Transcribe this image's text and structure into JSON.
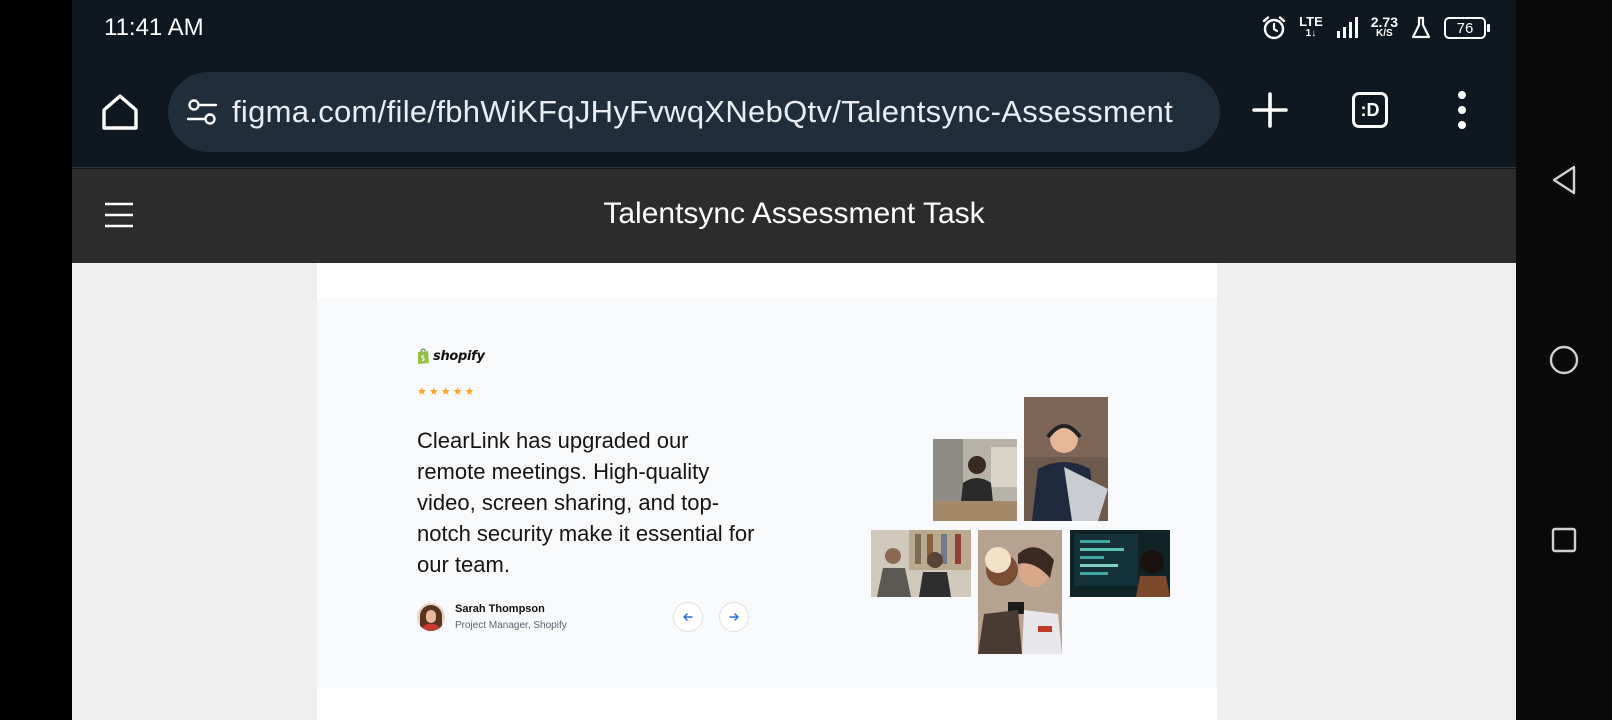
{
  "status_bar": {
    "time": "11:41 AM",
    "network": "LTE",
    "network_sub": "1↓",
    "speed": "2.73",
    "speed_unit": "K/S",
    "battery": "76"
  },
  "browser": {
    "url": "figma.com/file/fbhWiKFqJHyFvwqXNebQtv/Talentsync-Assessment",
    "tabs_label": ":D"
  },
  "figma": {
    "file_title": "Talentsync Assessment Task"
  },
  "testimonial": {
    "brand": "shopify",
    "rating": 5,
    "stars": [
      "★",
      "★",
      "★",
      "★",
      "★"
    ],
    "quote": "ClearLink has upgraded our remote meetings. High-quality video, screen sharing, and top-notch security make it essential for our team.",
    "author_name": "Sarah Thompson",
    "author_role": "Project Manager, Shopify"
  },
  "colors": {
    "star": "#f5a623",
    "shopify_green": "#95bf47",
    "figma_header": "#2c2c2c",
    "browser_bg": "#0f1720"
  },
  "icons": {
    "home": "home-icon",
    "site_settings": "tune-icon",
    "new_tab": "plus-icon",
    "overflow": "more-vert-icon",
    "menu": "hamburger-icon",
    "prev": "arrow-left-icon",
    "next": "arrow-right-icon",
    "back": "triangle-back-icon",
    "home_nav": "circle-home-icon",
    "recents": "square-recents-icon"
  }
}
